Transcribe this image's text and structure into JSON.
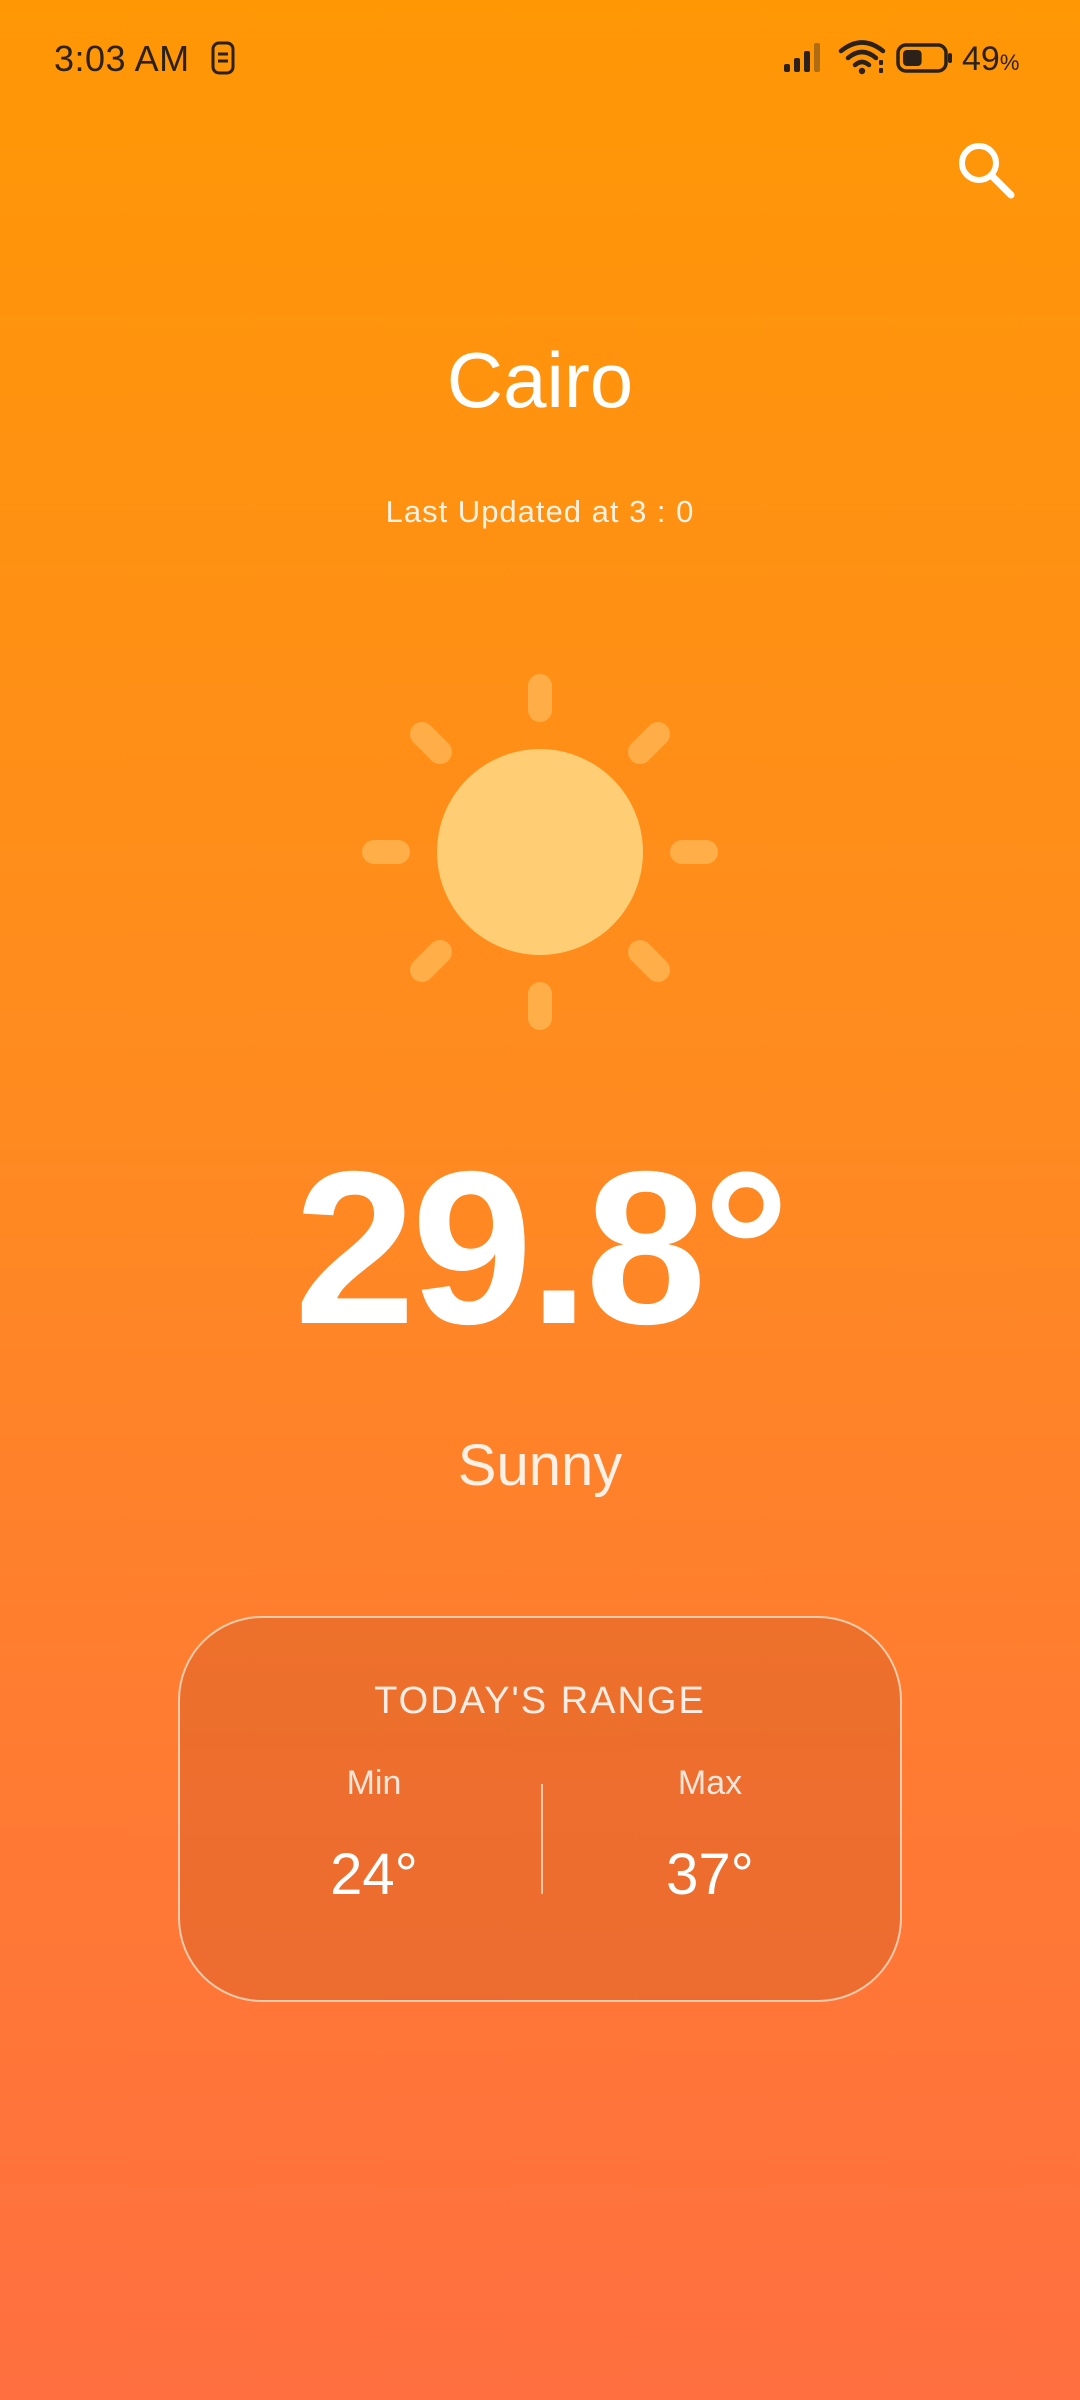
{
  "status_bar": {
    "time": "3:03 AM",
    "battery_value": "49",
    "battery_unit": "%",
    "notification_icon": "sim-card-icon",
    "signal_icon": "cellular-signal-icon",
    "wifi_icon": "wifi-icon",
    "battery_icon": "battery-icon",
    "battery_level": 0.49
  },
  "header": {
    "search_icon": "search-icon",
    "city": "Cairo",
    "last_updated": "Last Updated at 3 : 0"
  },
  "weather": {
    "icon": "sun-icon",
    "temperature": "29.8°",
    "condition": "Sunny"
  },
  "range": {
    "title": "TODAY'S RANGE",
    "min_label": "Min",
    "min_value": "24°",
    "max_label": "Max",
    "max_value": "37°"
  },
  "colors": {
    "background_top": "#FF9705",
    "background_bottom": "#FF6F40",
    "sun_core": "#FFCD73",
    "sun_rays": "#FFB24D"
  }
}
